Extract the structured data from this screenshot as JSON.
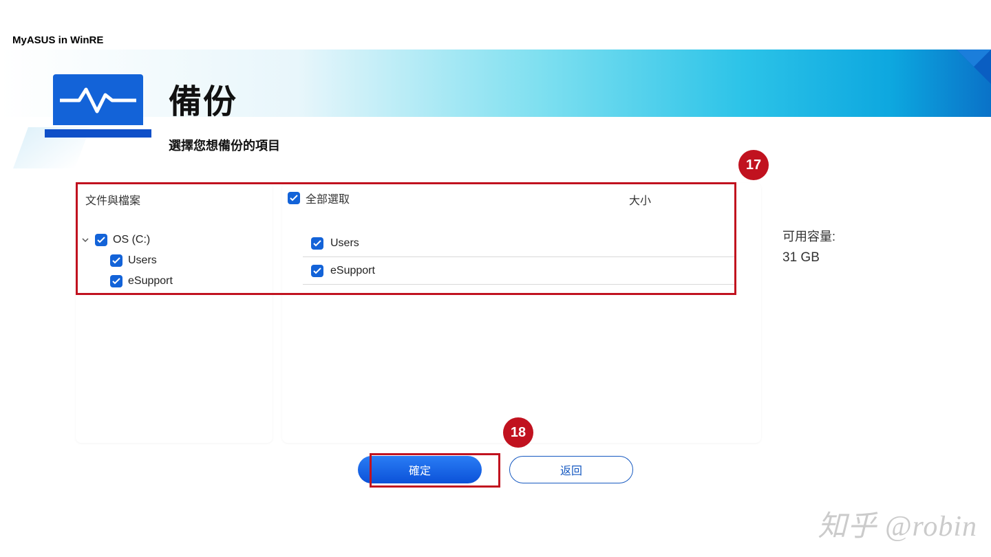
{
  "app_title": "MyASUS in WinRE",
  "page": {
    "title": "備份",
    "subtitle": "選擇您想備份的項目"
  },
  "headers": {
    "docs": "文件與檔案",
    "select_all": "全部選取",
    "size": "大小"
  },
  "tree": {
    "root": "OS (C:)",
    "children": [
      "Users",
      "eSupport"
    ]
  },
  "details": {
    "items": [
      "Users",
      "eSupport"
    ]
  },
  "capacity": {
    "label": "可用容量:",
    "value": "31 GB"
  },
  "buttons": {
    "ok": "確定",
    "back": "返回"
  },
  "callouts": {
    "a": "17",
    "b": "18"
  },
  "watermark": "知乎 @robin"
}
